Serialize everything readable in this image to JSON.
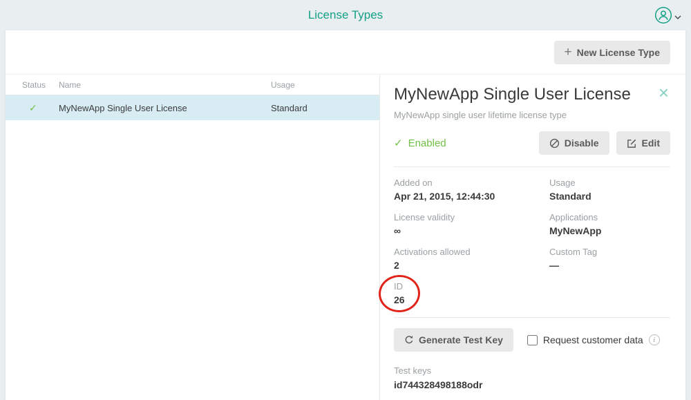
{
  "header": {
    "title": "License Types"
  },
  "toolbar": {
    "new_button_label": "New License Type"
  },
  "table": {
    "columns": [
      "Status",
      "Name",
      "Usage"
    ],
    "rows": [
      {
        "name": "MyNewApp Single User License",
        "usage": "Standard"
      }
    ]
  },
  "detail": {
    "title": "MyNewApp Single User License",
    "subtitle": "MyNewApp single user lifetime license type",
    "status_label": "Enabled",
    "disable_button": "Disable",
    "edit_button": "Edit",
    "fields": [
      {
        "label": "Added on",
        "value": "Apr 21, 2015, 12:44:30"
      },
      {
        "label": "Usage",
        "value": "Standard"
      },
      {
        "label": "License validity",
        "value": "∞"
      },
      {
        "label": "Applications",
        "value": "MyNewApp"
      },
      {
        "label": "Activations allowed",
        "value": "2"
      },
      {
        "label": "Custom Tag",
        "value": "—"
      },
      {
        "label": "ID",
        "value": "26"
      }
    ],
    "generate_button": "Generate Test Key",
    "request_checkbox_label": "Request customer data",
    "test_keys_label": "Test keys",
    "test_key_value": "id744328498188odr"
  },
  "colors": {
    "accent": "#14a085",
    "green": "#71bf44",
    "annotation": "#e2231a",
    "selected_row": "#d8ecf4"
  }
}
